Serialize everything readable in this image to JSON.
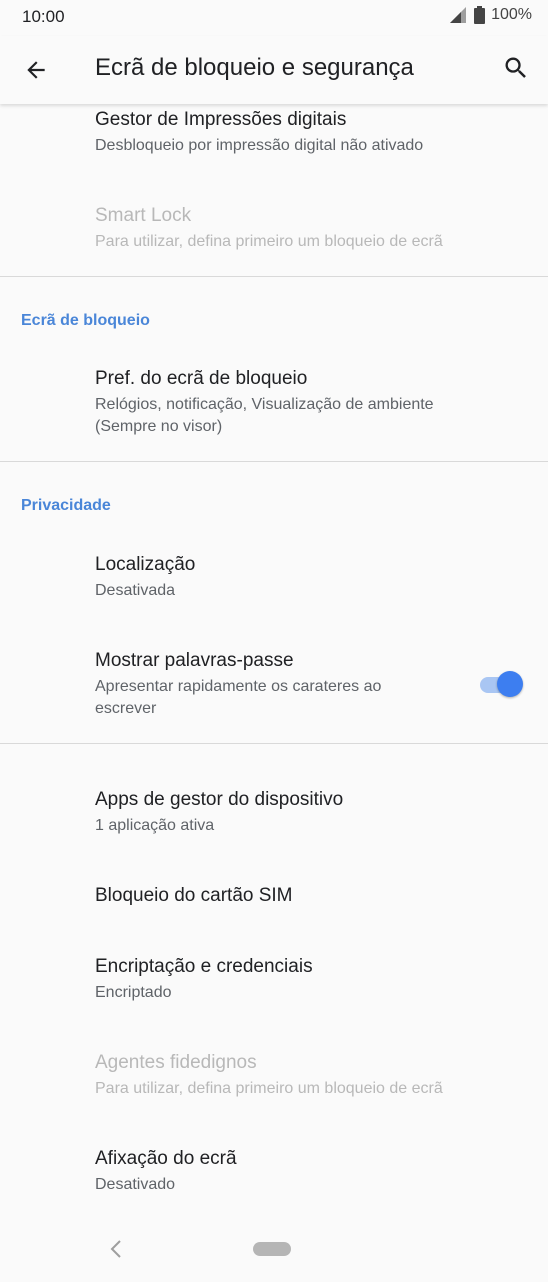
{
  "status": {
    "time": "10:00",
    "battery": "100%"
  },
  "app_bar": {
    "title": "Ecrã de bloqueio e segurança",
    "back_icon": "arrow-back-icon",
    "search_icon": "search-icon"
  },
  "items": {
    "fingerprint": {
      "title": "Gestor de Impressões digitais",
      "subtitle": "Desbloqueio por impressão digital não ativado"
    },
    "smart_lock": {
      "title": "Smart Lock",
      "subtitle": "Para utilizar, defina primeiro um bloqueio de ecrã"
    },
    "lock_prefs": {
      "title": "Pref. do ecrã de bloqueio",
      "subtitle_line1": "Relógios, notificação, Visualização de ambiente",
      "subtitle_line2": "(Sempre no visor)"
    },
    "location": {
      "title": "Localização",
      "subtitle": "Desativada"
    },
    "show_passwords": {
      "title": "Mostrar palavras-passe",
      "subtitle_line1": "Apresentar rapidamente os carateres ao",
      "subtitle_line2": "escrever",
      "toggle_on": true
    },
    "device_admin": {
      "title": "Apps de gestor do dispositivo",
      "subtitle": "1 aplicação ativa"
    },
    "sim_lock": {
      "title": "Bloqueio do cartão SIM"
    },
    "encryption": {
      "title": "Encriptação e credenciais",
      "subtitle": "Encriptado"
    },
    "trust_agents": {
      "title": "Agentes fidedignos",
      "subtitle": "Para utilizar, defina primeiro um bloqueio de ecrã"
    },
    "screen_pinning": {
      "title": "Afixação do ecrã",
      "subtitle": "Desativado"
    }
  },
  "sections": {
    "lock_screen": "Ecrã de bloqueio",
    "privacy": "Privacidade"
  },
  "colors": {
    "accent": "#4a86d8",
    "toggle_thumb": "#3d7ef0",
    "toggle_track": "#a9c6f3"
  }
}
